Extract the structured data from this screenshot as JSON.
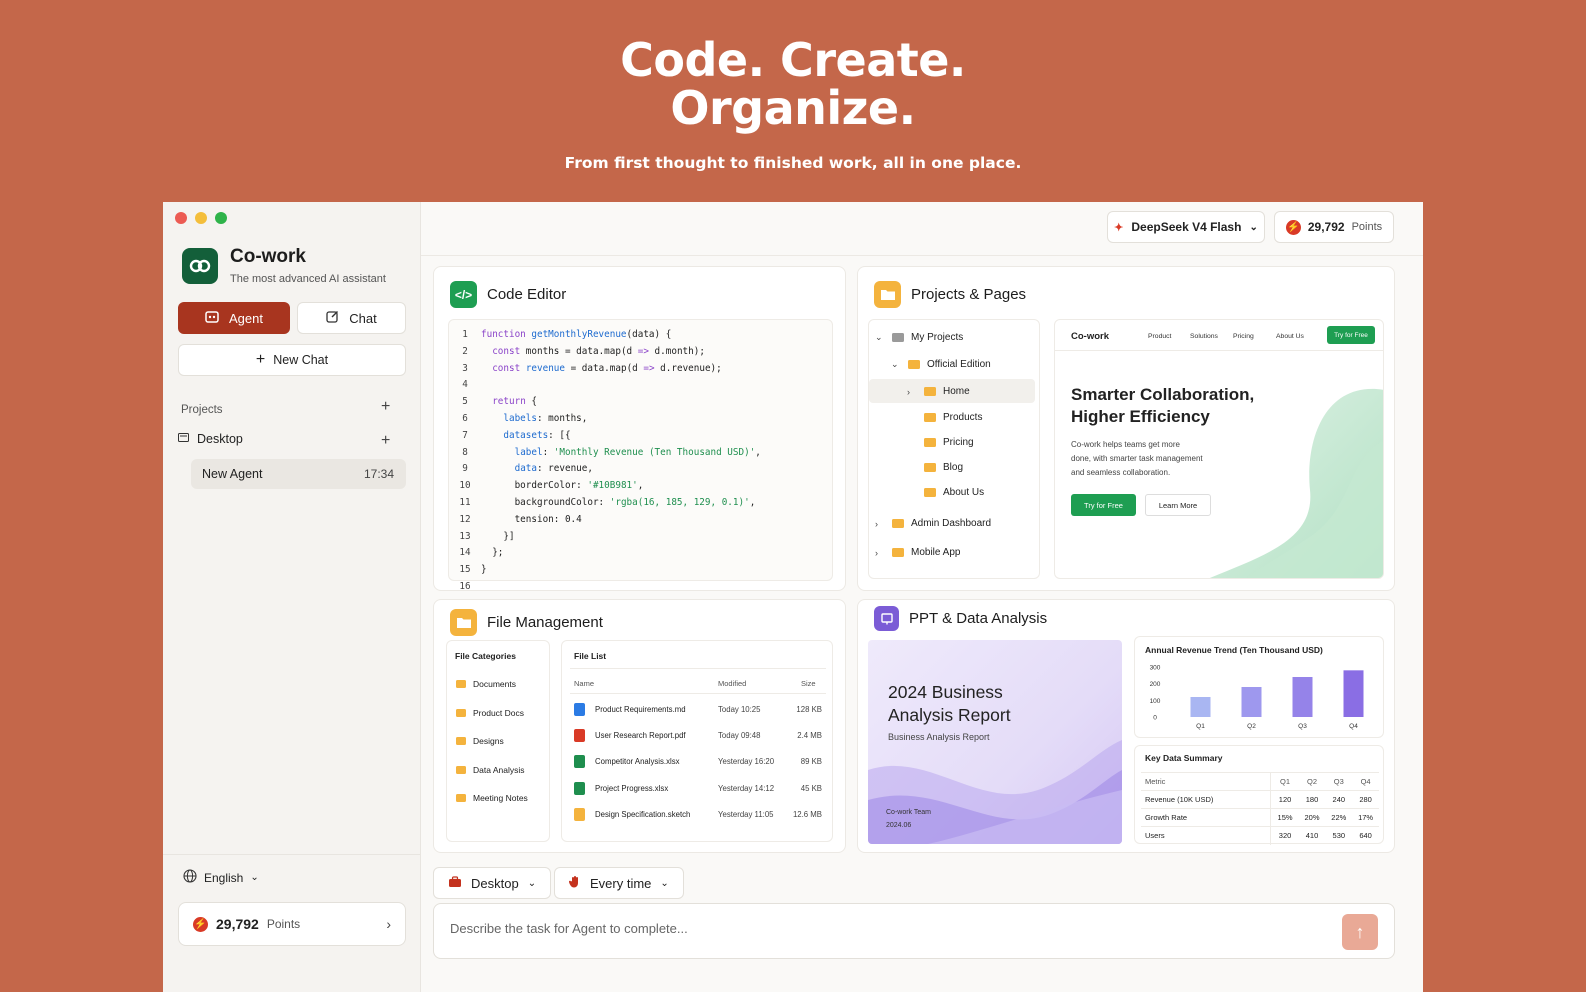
{
  "hero": {
    "title_line1": "Code. Create.",
    "title_line2": "Organize.",
    "subtitle": "From first thought to finished work, all in one place."
  },
  "sidebar": {
    "app_title": "Co-work",
    "app_subtitle": "The most advanced AI assistant",
    "agent_label": "Agent",
    "chat_label": "Chat",
    "new_chat_label": "New Chat",
    "projects_label": "Projects",
    "desktop_label": "Desktop",
    "agent_item": {
      "label": "New Agent",
      "time": "17:34"
    },
    "language": "English",
    "points": {
      "value": "29,792",
      "label": "Points"
    }
  },
  "topbar": {
    "model": "DeepSeek V4 Flash",
    "points": {
      "value": "29,792",
      "label": "Points"
    }
  },
  "code_editor": {
    "title": "Code Editor",
    "lines": [
      {
        "n": "1",
        "parts": [
          [
            "kw",
            "function "
          ],
          [
            "fn",
            "getMonthlyRevenue"
          ],
          [
            "plain",
            "(data) {"
          ]
        ]
      },
      {
        "n": "2",
        "parts": [
          [
            "plain",
            "  "
          ],
          [
            "kw",
            "const"
          ],
          [
            "plain",
            " months = data.map(d "
          ],
          [
            "kw",
            "=>"
          ],
          [
            "plain",
            " d.month);"
          ]
        ]
      },
      {
        "n": "3",
        "parts": [
          [
            "plain",
            "  "
          ],
          [
            "kw",
            "const"
          ],
          [
            "plain",
            " "
          ],
          [
            "fn",
            "revenue"
          ],
          [
            "plain",
            " = data.map(d "
          ],
          [
            "kw",
            "=>"
          ],
          [
            "plain",
            " d.revenue);"
          ]
        ]
      },
      {
        "n": "4",
        "parts": [
          [
            "plain",
            ""
          ]
        ]
      },
      {
        "n": "5",
        "parts": [
          [
            "plain",
            "  "
          ],
          [
            "kw",
            "return"
          ],
          [
            "plain",
            " {"
          ]
        ]
      },
      {
        "n": "6",
        "parts": [
          [
            "plain",
            "    "
          ],
          [
            "fn",
            "labels"
          ],
          [
            "plain",
            ": months,"
          ]
        ]
      },
      {
        "n": "7",
        "parts": [
          [
            "plain",
            "    "
          ],
          [
            "fn",
            "datasets"
          ],
          [
            "plain",
            ": [{"
          ]
        ]
      },
      {
        "n": "8",
        "parts": [
          [
            "plain",
            "      "
          ],
          [
            "fn",
            "label"
          ],
          [
            "plain",
            ": "
          ],
          [
            "str",
            "'Monthly Revenue (Ten Thousand USD)'"
          ],
          [
            "plain",
            ","
          ]
        ]
      },
      {
        "n": "9",
        "parts": [
          [
            "plain",
            "      "
          ],
          [
            "fn",
            "data"
          ],
          [
            "plain",
            ": revenue,"
          ]
        ]
      },
      {
        "n": "10",
        "parts": [
          [
            "plain",
            "      borderColor: "
          ],
          [
            "str",
            "'#10B981'"
          ],
          [
            "plain",
            ","
          ]
        ]
      },
      {
        "n": "11",
        "parts": [
          [
            "plain",
            "      backgroundColor: "
          ],
          [
            "str",
            "'rgba(16, 185, 129, 0.1)'"
          ],
          [
            "plain",
            ","
          ]
        ]
      },
      {
        "n": "12",
        "parts": [
          [
            "plain",
            "      tension: 0.4"
          ]
        ]
      },
      {
        "n": "13",
        "parts": [
          [
            "plain",
            "    }]"
          ]
        ]
      },
      {
        "n": "14",
        "parts": [
          [
            "plain",
            "  };"
          ]
        ]
      },
      {
        "n": "15",
        "parts": [
          [
            "plain",
            "}"
          ]
        ]
      }
    ],
    "extra_line_number": "16"
  },
  "projects": {
    "title": "Projects & Pages",
    "tree": {
      "my_projects": "My Projects",
      "official": "Official Edition",
      "home": "Home",
      "products": "Products",
      "pricing": "Pricing",
      "blog": "Blog",
      "about": "About Us",
      "admin": "Admin Dashboard",
      "mobile": "Mobile App"
    },
    "preview": {
      "brand": "Co-work",
      "nav": [
        "Product",
        "Solutions",
        "Pricing",
        "About Us"
      ],
      "nav_cta": "Try for Free",
      "headline1": "Smarter Collaboration,",
      "headline2": "Higher Efficiency",
      "body1": "Co-work helps teams get more",
      "body2": "done, with smarter task management",
      "body3": "and seamless collaboration.",
      "cta_primary": "Try for Free",
      "cta_secondary": "Learn More"
    }
  },
  "files": {
    "title": "File Management",
    "categories_title": "File Categories",
    "categories": [
      "Documents",
      "Product Docs",
      "Designs",
      "Data Analysis",
      "Meeting Notes"
    ],
    "list_title": "File List",
    "columns": [
      "Name",
      "Modified",
      "Size"
    ],
    "rows": [
      {
        "name": "Product Requirements.md",
        "modified": "Today 10:25",
        "size": "128 KB",
        "icon": "doc-icon",
        "color": "#2B7BE4"
      },
      {
        "name": "User Research Report.pdf",
        "modified": "Today 09:48",
        "size": "2.4 MB",
        "icon": "pdf-icon",
        "color": "#D93A26"
      },
      {
        "name": "Competitor Analysis.xlsx",
        "modified": "Yesterday 16:20",
        "size": "89 KB",
        "icon": "excel-icon",
        "color": "#1E8E4E"
      },
      {
        "name": "Project Progress.xlsx",
        "modified": "Yesterday 14:12",
        "size": "45 KB",
        "icon": "excel-icon",
        "color": "#1E8E4E"
      },
      {
        "name": "Design Specification.sketch",
        "modified": "Yesterday 11:05",
        "size": "12.6 MB",
        "icon": "sketch-icon",
        "color": "#F4B33D"
      }
    ]
  },
  "ppt": {
    "title": "PPT & Data Analysis",
    "slide": {
      "title1": "2024 Business",
      "title2": "Analysis Report",
      "subtitle": "Business Analysis Report",
      "team": "Co-work Team",
      "date": "2024.06"
    },
    "summary_title": "Key Data Summary",
    "summary_headers": [
      "Metric",
      "Q1",
      "Q2",
      "Q3",
      "Q4"
    ],
    "summary_rows": [
      [
        "Revenue (10K USD)",
        "120",
        "180",
        "240",
        "280"
      ],
      [
        "Growth Rate",
        "15%",
        "20%",
        "22%",
        "17%"
      ],
      [
        "Users",
        "320",
        "410",
        "530",
        "640"
      ]
    ]
  },
  "chart_data": {
    "type": "bar",
    "title": "Annual Revenue Trend (Ten Thousand USD)",
    "categories": [
      "Q1",
      "Q2",
      "Q3",
      "Q4"
    ],
    "values": [
      120,
      180,
      240,
      280
    ],
    "yticks": [
      "300",
      "200",
      "100",
      "0"
    ],
    "ylim": [
      0,
      300
    ],
    "colors": [
      "#A9B6F2",
      "#9E98EE",
      "#9583E9",
      "#8A6EE4"
    ]
  },
  "bottom": {
    "workspace": "Desktop",
    "schedule": "Every time",
    "input_placeholder": "Describe the task for Agent to complete..."
  },
  "colors": {
    "background": "#C4674A",
    "accent": "#A8351F",
    "brand_green": "#135F3A",
    "cta_green": "#1E9E52"
  }
}
